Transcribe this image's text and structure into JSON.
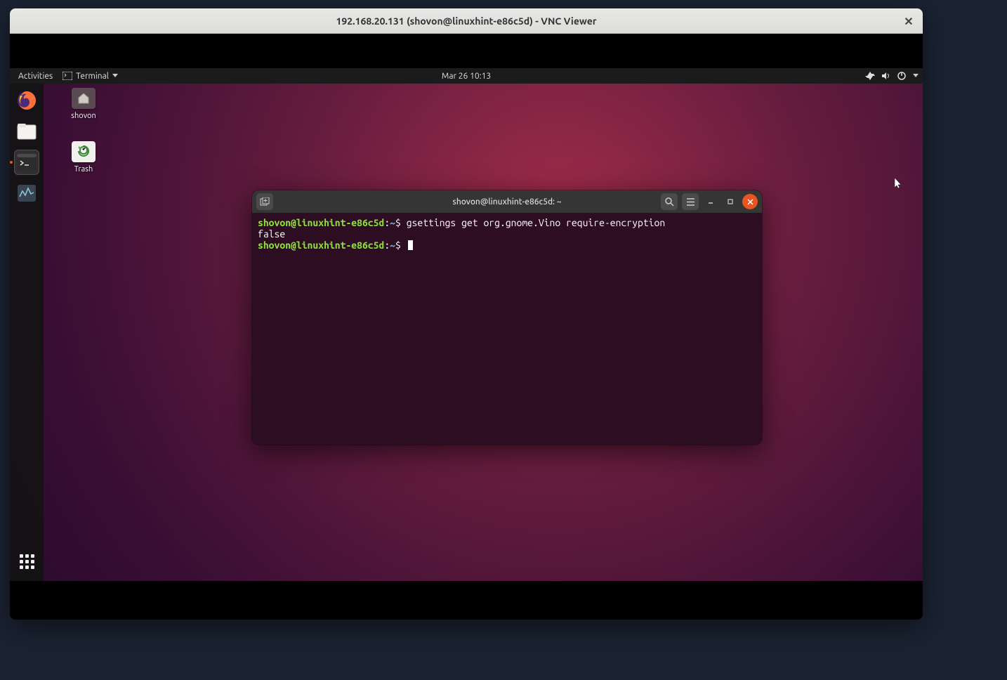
{
  "vnc": {
    "title": "192.168.20.131 (shovon@linuxhint-e86c5d) - VNC Viewer",
    "close_glyph": "✕"
  },
  "topbar": {
    "activities": "Activities",
    "app_name": "Terminal",
    "clock": "Mar 26  10:13"
  },
  "desktop_icons": {
    "home_label": "shovon",
    "trash_label": "Trash"
  },
  "terminal": {
    "window_title": "shovon@linuxhint-e86c5d: ~",
    "prompt_user": "shovon@linuxhint-e86c5d",
    "prompt_sep": ":",
    "prompt_path": "~",
    "prompt_sym": "$",
    "cmd1": " gsettings get org.gnome.Vino require-encryption",
    "out1": "false",
    "cmd2": " "
  }
}
